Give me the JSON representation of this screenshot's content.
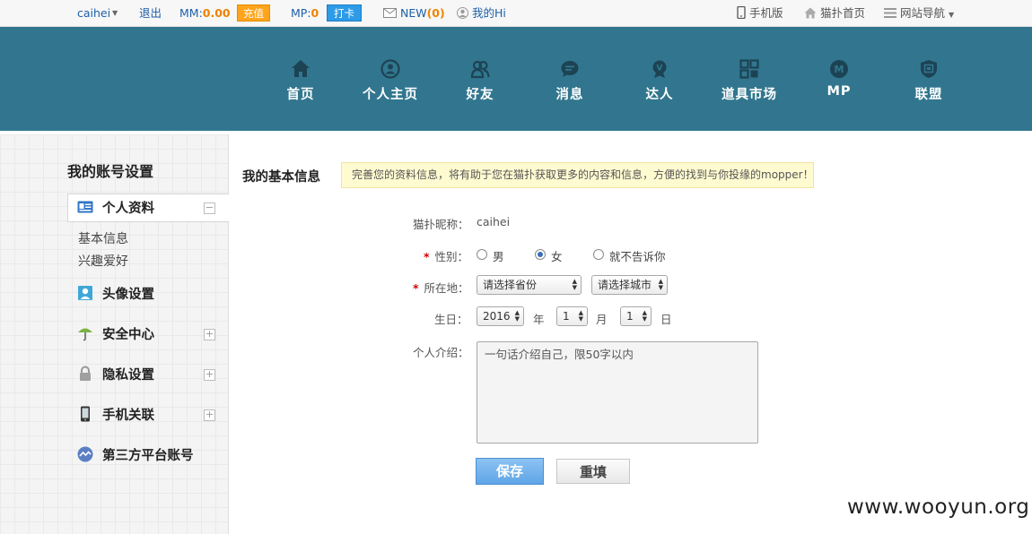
{
  "topbar": {
    "username": "caihei",
    "logout": "退出",
    "mm_label": "MM:",
    "mm_value": "0.00",
    "recharge": "充值",
    "mp_label": "MP:",
    "mp_value": "0",
    "checkin": "打卡",
    "new_label": "NEW",
    "new_count": "(0)",
    "my_hi": "我的Hi",
    "mobile": "手机版",
    "home": "猫扑首页",
    "site_nav": "网站导航"
  },
  "nav": {
    "items": [
      {
        "label": "首页",
        "icon": "home-icon"
      },
      {
        "label": "个人主页",
        "icon": "profile-icon"
      },
      {
        "label": "好友",
        "icon": "friends-icon"
      },
      {
        "label": "消息",
        "icon": "message-icon"
      },
      {
        "label": "达人",
        "icon": "expert-icon"
      },
      {
        "label": "道具市场",
        "icon": "market-icon"
      },
      {
        "label": "MP",
        "icon": "mp-icon"
      },
      {
        "label": "联盟",
        "icon": "alliance-icon"
      }
    ]
  },
  "sidebar": {
    "title": "我的账号设置",
    "items": [
      {
        "label": "个人资料",
        "expanded": true,
        "toggle": "−"
      },
      {
        "label": "头像设置"
      },
      {
        "label": "安全中心",
        "toggle": "+"
      },
      {
        "label": "隐私设置",
        "toggle": "+"
      },
      {
        "label": "手机关联",
        "toggle": "+"
      },
      {
        "label": "第三方平台账号"
      }
    ],
    "subitems": [
      "基本信息",
      "兴趣爱好"
    ]
  },
  "main": {
    "section_title": "我的基本信息",
    "tip": "完善您的资料信息，将有助于您在猫扑获取更多的内容和信息，方便的找到与你投缘的mopper！",
    "nickname_label": "猫扑昵称：",
    "nickname_value": "caihei",
    "gender_label": "性别：",
    "gender_options": [
      "男",
      "女",
      "就不告诉你"
    ],
    "gender_selected": "女",
    "location_label": "所在地：",
    "province_select": "请选择省份",
    "city_select": "请选择城市",
    "birthday_label": "生日：",
    "birth_year": "2016",
    "year_unit": "年",
    "birth_month": "1",
    "month_unit": "月",
    "birth_day": "1",
    "day_unit": "日",
    "intro_label": "个人介绍：",
    "intro_placeholder": "一句话介绍自己，限50字以内",
    "required_mark": "*",
    "save": "保存",
    "reset": "重填"
  },
  "watermark": "www.wooyun.org"
}
